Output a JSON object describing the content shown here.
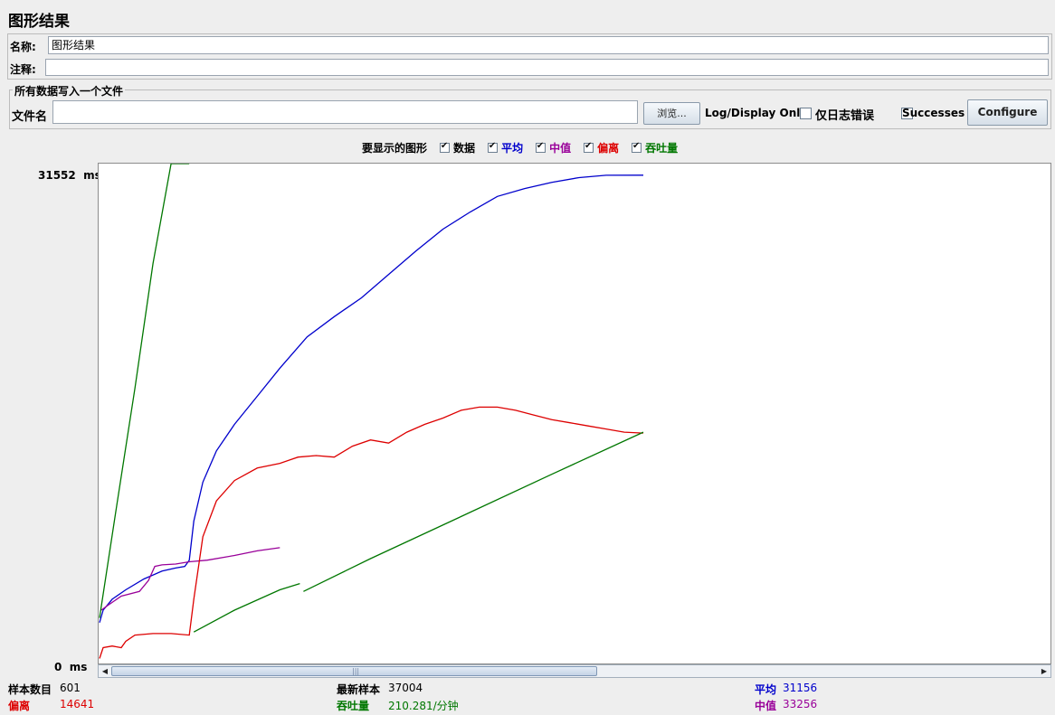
{
  "window": {
    "title": "图形结果"
  },
  "form": {
    "name_label": "名称:",
    "name_value": "图形结果",
    "comment_label": "注释:",
    "comment_value": ""
  },
  "file_group": {
    "title": "所有数据写入一个文件",
    "filename_label": "文件名",
    "filename_value": "",
    "browse_label": "浏览...",
    "log_display_label": "Log/Display Only:",
    "errors_only_label": "仅日志错误",
    "errors_only_checked": false,
    "successes_label": "Successes",
    "successes_checked": false,
    "configure_label": "Configure"
  },
  "display_options": {
    "label": "要显示的图形",
    "items": [
      {
        "label": "数据",
        "checked": true,
        "color": "#000000"
      },
      {
        "label": "平均",
        "checked": true,
        "color": "#0000cc"
      },
      {
        "label": "中值",
        "checked": true,
        "color": "#990099"
      },
      {
        "label": "偏离",
        "checked": true,
        "color": "#dd0000"
      },
      {
        "label": "吞吐量",
        "checked": true,
        "color": "#007700"
      }
    ]
  },
  "chart_data": {
    "type": "line",
    "y_max_label": "31552  ms",
    "y_min_label": "0  ms",
    "ylim": [
      0,
      31552
    ],
    "xlim": [
      0,
      601
    ],
    "grid": false,
    "series": [
      {
        "name": "平均",
        "color": "#0000cc",
        "x": [
          1,
          5,
          15,
          30,
          50,
          70,
          85,
          95,
          100,
          105,
          115,
          130,
          150,
          175,
          200,
          230,
          260,
          290,
          320,
          350,
          380,
          410,
          440,
          470,
          500,
          530,
          560,
          601
        ],
        "y": [
          2500,
          3300,
          4000,
          4600,
          5300,
          5800,
          6000,
          6100,
          6500,
          9000,
          11500,
          13500,
          15200,
          17000,
          18800,
          20800,
          22100,
          23300,
          24800,
          26300,
          27700,
          28800,
          29800,
          30300,
          30700,
          31000,
          31150,
          31156
        ]
      },
      {
        "name": "中值",
        "color": "#990099",
        "x": [
          3,
          10,
          25,
          45,
          55,
          62,
          70,
          85,
          100,
          120,
          150,
          175,
          200
        ],
        "y": [
          3300,
          3600,
          4200,
          4500,
          5200,
          6100,
          6200,
          6250,
          6400,
          6500,
          6800,
          7100,
          7300
        ]
      },
      {
        "name": "偏离",
        "color": "#dd0000",
        "x": [
          1,
          5,
          15,
          25,
          30,
          40,
          60,
          80,
          100,
          105,
          115,
          130,
          150,
          175,
          200,
          220,
          240,
          260,
          280,
          300,
          320,
          340,
          360,
          380,
          400,
          420,
          440,
          460,
          480,
          500,
          520,
          540,
          560,
          580,
          601
        ],
        "y": [
          200,
          900,
          1000,
          900,
          1300,
          1700,
          1800,
          1800,
          1700,
          4000,
          8000,
          10300,
          11600,
          12400,
          12700,
          13100,
          13200,
          13100,
          13800,
          14200,
          14000,
          14700,
          15200,
          15600,
          16100,
          16300,
          16300,
          16100,
          15800,
          15500,
          15300,
          15100,
          14900,
          14700,
          14641
        ]
      },
      {
        "name": "吞吐量",
        "color": "#007700",
        "x": [
          1,
          20,
          40,
          60,
          80,
          90,
          100,
          105,
          150,
          200,
          222,
          226,
          300,
          400,
          500,
          601
        ],
        "y": [
          2800,
          10000,
          17500,
          25500,
          33500,
          37700,
          41000,
          1900,
          3300,
          4600,
          5000,
          4500,
          6600,
          9300,
          12000,
          14700
        ]
      }
    ]
  },
  "stats": {
    "sample_count_label": "样本数目",
    "sample_count_value": "601",
    "latest_sample_label": "最新样本",
    "latest_sample_value": "37004",
    "average_label": "平均",
    "average_value": "31156",
    "deviation_label": "偏离",
    "deviation_value": "14641",
    "throughput_label": "吞吐量",
    "throughput_value": "210.281/分钟",
    "median_label": "中值",
    "median_value": "33256"
  }
}
